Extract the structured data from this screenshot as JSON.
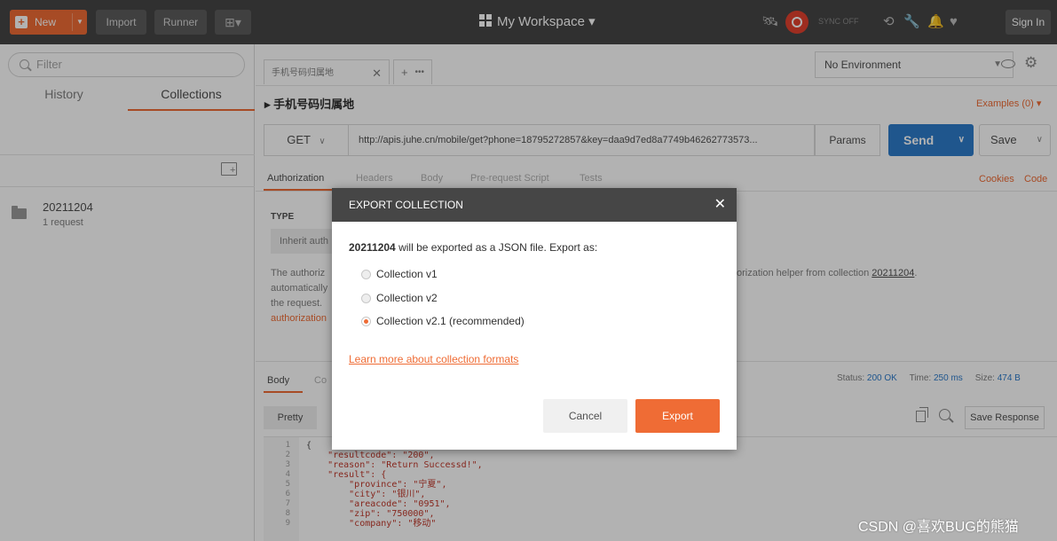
{
  "topbar": {
    "new_label": "New",
    "import_label": "Import",
    "runner_label": "Runner",
    "workspace_label": "My Workspace",
    "sync_label": "SYNC OFF",
    "signin_label": "Sign In"
  },
  "sidebar": {
    "filter_placeholder": "Filter",
    "tabs": [
      {
        "label": "History"
      },
      {
        "label": "Collections"
      }
    ],
    "active_tab": "Collections",
    "collections": [
      {
        "name": "20211204",
        "count": "1 request"
      }
    ]
  },
  "request": {
    "tab_title": "手机号码归属地",
    "environment": "No Environment",
    "name": "手机号码归属地",
    "examples": "Examples (0)",
    "method": "GET",
    "url": "http://apis.juhe.cn/mobile/get?phone=18795272857&key=daa9d7ed8a7749b46262773573...",
    "params_label": "Params",
    "send_label": "Send",
    "save_label": "Save",
    "tabs": [
      "Authorization",
      "Headers",
      "Body",
      "Pre-request Script",
      "Tests"
    ],
    "cookies_link": "Cookies",
    "code_link": "Code",
    "type_label": "TYPE",
    "type_value": "Inherit auth",
    "auth_text_left_1": "The authoriz",
    "auth_text_left_2": "automatically",
    "auth_text_left_3": "the request.",
    "auth_text_left_4": "authorization",
    "auth_text_right": "orization helper from collection",
    "auth_text_collection": "20211204"
  },
  "response": {
    "tabs": [
      "Body",
      "Co"
    ],
    "status_label": "Status:",
    "status_value": "200 OK",
    "time_label": "Time:",
    "time_value": "250 ms",
    "size_label": "Size:",
    "size_value": "474 B",
    "pretty_label": "Pretty",
    "save_response_label": "Save Response",
    "lines": [
      {
        "n": "1",
        "t": "{"
      },
      {
        "n": "2",
        "t": "    \"resultcode\": \"200\","
      },
      {
        "n": "3",
        "t": "    \"reason\": \"Return Successd!\","
      },
      {
        "n": "4",
        "t": "    \"result\": {"
      },
      {
        "n": "5",
        "t": "        \"province\": \"宁夏\","
      },
      {
        "n": "6",
        "t": "        \"city\": \"银川\","
      },
      {
        "n": "7",
        "t": "        \"areacode\": \"0951\","
      },
      {
        "n": "8",
        "t": "        \"zip\": \"750000\","
      },
      {
        "n": "9",
        "t": "        \"company\": \"移动\""
      }
    ]
  },
  "modal": {
    "title": "EXPORT COLLECTION",
    "collection_name": "20211204",
    "message": "will be exported as a JSON file. Export as:",
    "options": [
      {
        "label": "Collection v1",
        "checked": false
      },
      {
        "label": "Collection v2",
        "checked": false
      },
      {
        "label": "Collection v2.1 (recommended)",
        "checked": true
      }
    ],
    "learn_more": "Learn more about collection formats",
    "cancel_label": "Cancel",
    "export_label": "Export"
  },
  "watermark": "CSDN @喜欢BUG的熊猫",
  "colors": {
    "accent": "#ef6c35",
    "topbar": "#464646",
    "send": "#2d7bcb"
  }
}
